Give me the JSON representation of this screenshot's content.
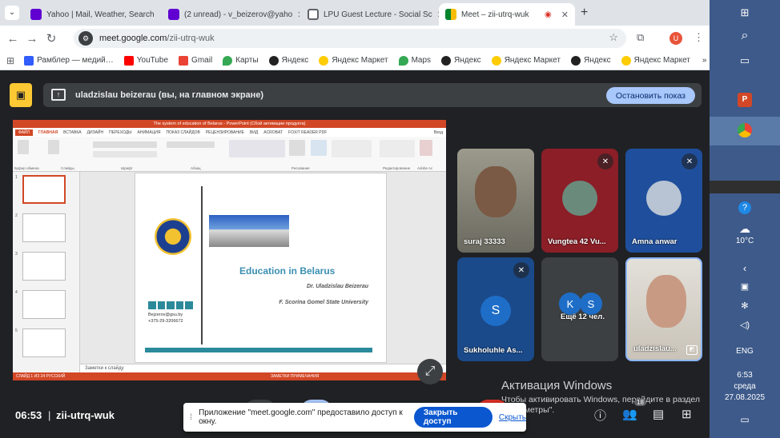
{
  "browser": {
    "tabs": [
      {
        "title": "Yahoo | Mail, Weather, Search",
        "icon": "yahoo-icon",
        "color": "#6001d2"
      },
      {
        "title": "(2 unread) - v_beizerov@yaho",
        "icon": "yahoo-mail-icon",
        "color": "#6001d2"
      },
      {
        "title": "LPU Guest Lecture - Social Sc",
        "icon": "classroom-icon",
        "color": "#5f6368"
      },
      {
        "title": "Meet – zii-utrq-wuk",
        "icon": "meet-icon",
        "color": "#00832d"
      }
    ],
    "new_tab": "+",
    "url_host": "meet.google.com",
    "url_path": "/zii-utrq-wuk",
    "profile_initial": "U",
    "bookmarks": [
      {
        "label": "Рамблер — медий…",
        "icon": "rambler-icon",
        "color": "#315efb"
      },
      {
        "label": "YouTube",
        "icon": "youtube-icon",
        "color": "#ff0000"
      },
      {
        "label": "Gmail",
        "icon": "gmail-icon",
        "color": "#ea4335"
      },
      {
        "label": "Карты",
        "icon": "maps-icon",
        "color": "#34a853"
      },
      {
        "label": "Яндекс",
        "icon": "yandex-icon",
        "color": "#222222"
      },
      {
        "label": "Яндекс Маркет",
        "icon": "market-icon",
        "color": "#ffcc00"
      },
      {
        "label": "Maps",
        "icon": "maps-icon",
        "color": "#34a853"
      },
      {
        "label": "Яндекс",
        "icon": "yandex-icon",
        "color": "#222222"
      },
      {
        "label": "Яндекс Маркет",
        "icon": "market-icon",
        "color": "#ffcc00"
      },
      {
        "label": "Яндекс",
        "icon": "yandex-icon",
        "color": "#222222"
      },
      {
        "label": "Яндекс Маркет",
        "icon": "market-icon",
        "color": "#ffcc00"
      }
    ],
    "more": "»"
  },
  "meet": {
    "banner_text": "uladzislau beizerau (вы, на главном экране)",
    "stop_button": "Остановить показ",
    "participants": [
      {
        "name": "suraj 33333",
        "muted": false
      },
      {
        "name": "Vungtea 42 Vu...",
        "muted": true
      },
      {
        "name": "Amna anwar",
        "muted": true
      },
      {
        "name": "Sukholuhle As...",
        "muted": true,
        "initial": "S",
        "color": "#1e5f9e"
      },
      {
        "name": "Ещё 12 чел.",
        "initials": [
          "K",
          "S"
        ],
        "color": "#1e5f9e"
      },
      {
        "name": "uladzislau...",
        "muted": false
      }
    ],
    "time": "06:53",
    "meeting_code": "zii-utrq-wuk",
    "toast_message": "Приложение \"meet.google.com\" предоставило доступ к окну.",
    "toast_stop": "Закрыть доступ",
    "toast_hide": "Скрыть",
    "participants_badge": "18",
    "activation_title": "Активация Windows",
    "activation_sub": "Чтобы активировать Windows, перейдите в раздел \"Параметры\"."
  },
  "ppt": {
    "window_title": "The system of education of Belarus - PowerPoint (Сбой активации продукта)",
    "menu": [
      "ФАЙЛ",
      "ГЛАВНАЯ",
      "ВСТАВКА",
      "ДИЗАЙН",
      "ПЕРЕХОДЫ",
      "АНИМАЦИЯ",
      "ПОКАЗ СЛАЙДОВ",
      "РЕЦЕНЗИРОВАНИЕ",
      "ВИД",
      "ACROBAT",
      "FOXIT READER PDF"
    ],
    "login": "Вход",
    "groups": [
      "Буфер обмена",
      "Слайды",
      "Шрифт",
      "Абзац",
      "Рисование",
      "Редактирование",
      "Adobe Ac"
    ],
    "slide": {
      "title": "Education in Belarus",
      "author": "Dr. Uladzislau Beizerau",
      "university": "F. Scorina Gomel State University",
      "email": "Bejzerov@gsu.by",
      "phone": "+375-29-3206672"
    },
    "notes": "Заметки к слайду",
    "status": "СЛАЙД 1 ИЗ 24    РУССКИЙ",
    "status_right": "ЗАМЕТКИ    ПРИМЕЧАНИЯ",
    "slide_numbers": [
      "1",
      "2",
      "3",
      "4",
      "5"
    ]
  },
  "taskbar": {
    "temperature": "10°C",
    "language": "ENG",
    "time": "6:53",
    "weekday": "среда",
    "date": "27.08.2025"
  }
}
